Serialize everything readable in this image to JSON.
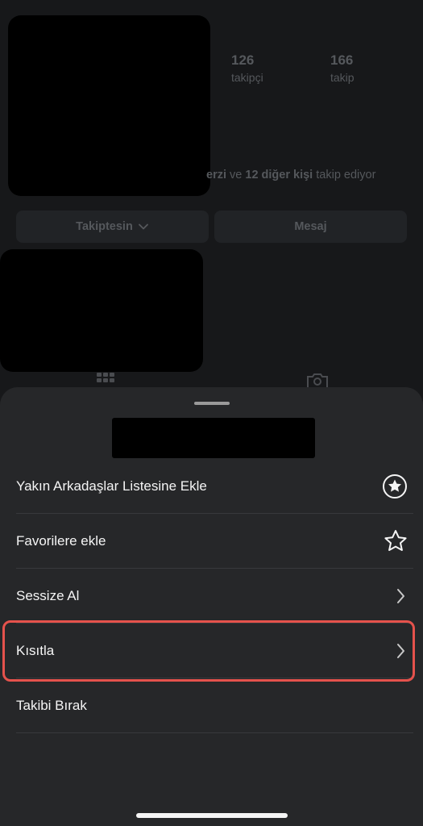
{
  "profile": {
    "followers_count": "126",
    "followers_label": "takipçi",
    "following_count": "166",
    "following_label": "takip",
    "followed_by_prefix": "erzi",
    "followed_by_ve": "ve",
    "followed_by_others": "12 diğer kişi",
    "followed_by_suffix": "takip ediyor",
    "following_button": "Takiptesin",
    "message_button": "Mesaj"
  },
  "sheet": {
    "items": [
      {
        "label": "Yakın Arkadaşlar Listesine Ekle",
        "icon": "close-friends-star-circle-icon"
      },
      {
        "label": "Favorilere ekle",
        "icon": "star-outline-icon"
      },
      {
        "label": "Sessize Al",
        "icon": "chevron-right-icon"
      },
      {
        "label": "Kısıtla",
        "icon": "chevron-right-icon",
        "highlighted": true
      },
      {
        "label": "Takibi Bırak",
        "icon": ""
      }
    ]
  },
  "colors": {
    "sheet_background": "#262729",
    "highlight_border": "#e5524c",
    "background": "#131416"
  }
}
